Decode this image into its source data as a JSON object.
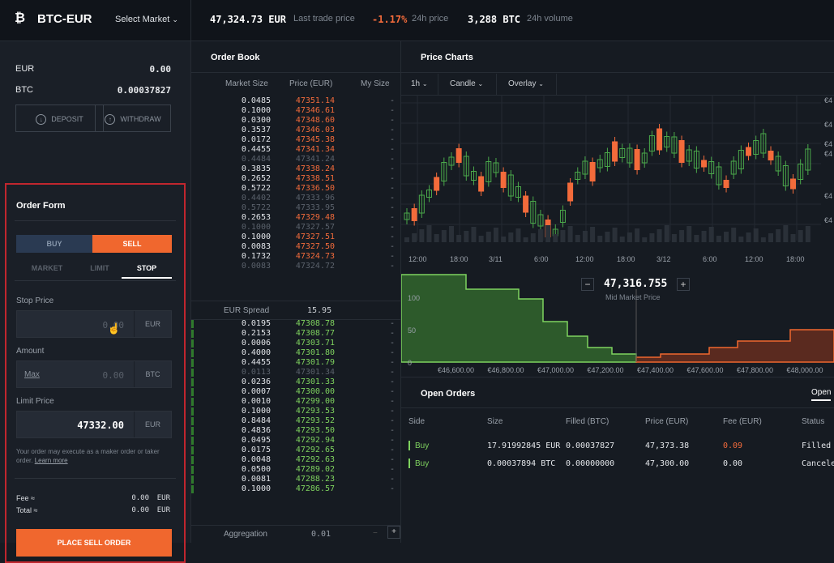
{
  "topbar": {
    "pair": "BTC-EUR",
    "select_market": "Select Market",
    "last_price": "47,324.73",
    "last_price_unit": "EUR",
    "last_price_label": "Last trade price",
    "change": "-1.17%",
    "change_label": "24h price",
    "volume": "3,288",
    "volume_unit": "BTC",
    "volume_label": "24h volume"
  },
  "balances": {
    "eur_label": "EUR",
    "eur_value": "0.00",
    "btc_label": "BTC",
    "btc_value": "0.00037827",
    "deposit": "DEPOSIT",
    "withdraw": "WITHDRAW"
  },
  "order_form": {
    "title": "Order Form",
    "buy": "BUY",
    "sell": "SELL",
    "tabs": [
      "MARKET",
      "LIMIT",
      "STOP"
    ],
    "stop_price_label": "Stop Price",
    "stop_price_value": "0.00",
    "stop_price_unit": "EUR",
    "amount_label": "Amount",
    "amount_max": "Max",
    "amount_value": "0.00",
    "amount_unit": "BTC",
    "limit_price_label": "Limit Price",
    "limit_price_value": "47332.00",
    "limit_price_unit": "EUR",
    "note": "Your order may execute as a maker order or taker order.",
    "learn_more": "Learn more",
    "fee_label": "Fee ≈",
    "fee_value": "0.00",
    "fee_unit": "EUR",
    "total_label": "Total ≈",
    "total_value": "0.00",
    "total_unit": "EUR",
    "place": "PLACE SELL ORDER"
  },
  "order_book": {
    "title": "Order Book",
    "col_size": "Market Size",
    "col_price": "Price (EUR)",
    "col_my": "My Size",
    "asks": [
      {
        "size": "0.0485",
        "price": "47351.14",
        "dim": false
      },
      {
        "size": "0.1000",
        "price": "47346.61",
        "dim": false
      },
      {
        "size": "0.0300",
        "price": "47348.60",
        "dim": false
      },
      {
        "size": "0.3537",
        "price": "47346.03",
        "dim": false
      },
      {
        "size": "0.0172",
        "price": "47345.38",
        "dim": false
      },
      {
        "size": "0.4455",
        "price": "47341.34",
        "dim": false
      },
      {
        "size": "0.4484",
        "price": "47341.24",
        "dim": true
      },
      {
        "size": "0.3835",
        "price": "47338.24",
        "dim": false
      },
      {
        "size": "0.2652",
        "price": "47338.51",
        "dim": false
      },
      {
        "size": "0.5722",
        "price": "47336.50",
        "dim": false
      },
      {
        "size": "0.4402",
        "price": "47333.96",
        "dim": true
      },
      {
        "size": "0.5722",
        "price": "47333.95",
        "dim": true
      },
      {
        "size": "0.2653",
        "price": "47329.48",
        "dim": false
      },
      {
        "size": "0.1000",
        "price": "47327.57",
        "dim": true
      },
      {
        "size": "0.1000",
        "price": "47327.51",
        "dim": false
      },
      {
        "size": "0.0083",
        "price": "47327.50",
        "dim": false
      },
      {
        "size": "0.1732",
        "price": "47324.73",
        "dim": false
      },
      {
        "size": "0.0083",
        "price": "47324.72",
        "dim": true
      }
    ],
    "spread_label": "EUR Spread",
    "spread_value": "15.95",
    "bids": [
      {
        "size": "0.0195",
        "price": "47308.78",
        "dim": false
      },
      {
        "size": "0.2153",
        "price": "47308.77",
        "dim": false
      },
      {
        "size": "0.0006",
        "price": "47303.71",
        "dim": false
      },
      {
        "size": "0.4000",
        "price": "47301.80",
        "dim": false
      },
      {
        "size": "0.4455",
        "price": "47301.79",
        "dim": false
      },
      {
        "size": "0.0113",
        "price": "47301.34",
        "dim": true
      },
      {
        "size": "0.0236",
        "price": "47301.33",
        "dim": false
      },
      {
        "size": "0.0007",
        "price": "47300.00",
        "dim": false
      },
      {
        "size": "0.0010",
        "price": "47299.00",
        "dim": false
      },
      {
        "size": "0.1000",
        "price": "47293.53",
        "dim": false
      },
      {
        "size": "0.8484",
        "price": "47293.52",
        "dim": false
      },
      {
        "size": "0.4836",
        "price": "47293.50",
        "dim": false
      },
      {
        "size": "0.0495",
        "price": "47292.94",
        "dim": false
      },
      {
        "size": "0.0175",
        "price": "47292.65",
        "dim": false
      },
      {
        "size": "0.0048",
        "price": "47292.63",
        "dim": false
      },
      {
        "size": "0.0500",
        "price": "47289.02",
        "dim": false
      },
      {
        "size": "0.0081",
        "price": "47288.23",
        "dim": false
      },
      {
        "size": "0.1000",
        "price": "47286.57",
        "dim": false
      }
    ],
    "aggregation_label": "Aggregation",
    "aggregation_value": "0.01",
    "my_size_dash": "-"
  },
  "price_charts": {
    "title": "Price Charts",
    "interval": "1h",
    "chart_type": "Candle",
    "overlay": "Overlay",
    "time_ticks": [
      "12:00",
      "18:00",
      "3/11",
      "6:00",
      "12:00",
      "18:00",
      "3/12",
      "6:00",
      "12:00",
      "18:00"
    ],
    "right_tick": "€4",
    "mid_price": "47,316.755",
    "mid_label": "Mid Market Price",
    "depth_y": [
      "100",
      "50",
      "0"
    ],
    "depth_x": [
      "€46,600.00",
      "€46,800.00",
      "€47,000.00",
      "€47,200.00",
      "€47,400.00",
      "€47,600.00",
      "€47,800.00",
      "€48,000.00"
    ]
  },
  "open_orders": {
    "title": "Open Orders",
    "tab": "Open",
    "headers": [
      "Side",
      "Size",
      "Filled (BTC)",
      "Price (EUR)",
      "Fee (EUR)",
      "Status"
    ],
    "rows": [
      {
        "side": "Buy",
        "size": "17.91992845 EUR",
        "filled": "0.00037827",
        "price": "47,373.38",
        "fee": "0.09",
        "status": "Filled"
      },
      {
        "side": "Buy",
        "size": "0.00037894 BTC",
        "filled": "0.00000000",
        "price": "47,300.00",
        "fee": "0.00",
        "status": "Cancele"
      }
    ]
  },
  "colors": {
    "accent": "#f0672e",
    "buy": "#7fd35f",
    "sell": "#f36b3b",
    "danger": "#c0262e"
  }
}
